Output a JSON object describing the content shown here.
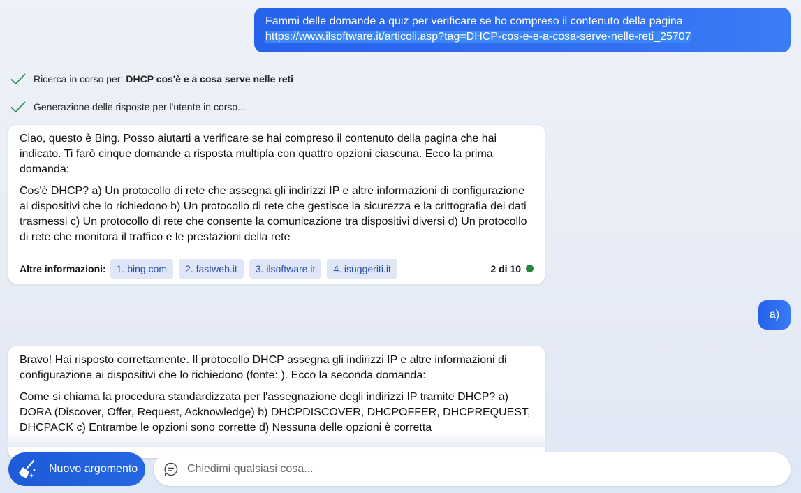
{
  "user_messages": {
    "first_line1": "Fammi delle domande a quiz per verificare se ho compreso il contenuto della pagina",
    "first_line2": "https://www.ilsoftware.it/articoli.asp?tag=DHCP-cos-e-e-a-cosa-serve-nelle-reti_25707",
    "second": "a)"
  },
  "status": {
    "search_prefix": "Ricerca in corso per:",
    "search_query": "DHCP cos'è e a cosa serve nelle reti",
    "generating": "Generazione delle risposte per l'utente in corso..."
  },
  "bot_card_1": {
    "paragraph1": "Ciao, questo è Bing. Posso aiutarti a verificare se hai compreso il contenuto della pagina che hai indicato. Ti farò cinque domande a risposta multipla con quattro opzioni ciascuna. Ecco la prima domanda:",
    "paragraph2": "Cos'è DHCP? a) Un protocollo di rete che assegna gli indirizzi IP e altre informazioni di configurazione ai dispositivi che lo richiedono b) Un protocollo di rete che gestisce la sicurezza e la crittografia dei dati trasmessi c) Un protocollo di rete che consente la comunicazione tra dispositivi diversi d) Un protocollo di rete che monitora il traffico e le prestazioni della rete",
    "more_info_label": "Altre informazioni:",
    "sources": [
      "1. bing.com",
      "2. fastweb.it",
      "3. ilsoftware.it",
      "4. isuggeriti.it"
    ],
    "counter": "2 di 10",
    "counter_color": "#22883a"
  },
  "bot_card_2": {
    "paragraph1": "Bravo! Hai risposto correttamente. Il protocollo DHCP assegna gli indirizzi IP e altre informazioni di configurazione ai dispositivi che lo richiedono (fonte: ). Ecco la seconda domanda:",
    "paragraph2": "Come si chiama la procedura standardizzata per l'assegnazione degli indirizzi IP tramite DHCP? a) DORA (Discover, Offer, Request, Acknowledge) b) DHCPDISCOVER, DHCPOFFER, DHCPREQUEST, DHCPACK c) Entrambe le opzioni sono corrette d) Nessuna delle opzioni è corretta"
  },
  "bottom_bar": {
    "new_topic_label": "Nuovo argomento",
    "new_topic_icon": "broom-icon",
    "input_placeholder": "Chiedimi qualsiasi cosa...",
    "input_icon": "chat-bubble-icon"
  },
  "colors": {
    "accent": "#2563eb",
    "check": "#1f8a4c",
    "chip_bg": "#dfe6f6",
    "chip_text": "#2a4fa8"
  }
}
